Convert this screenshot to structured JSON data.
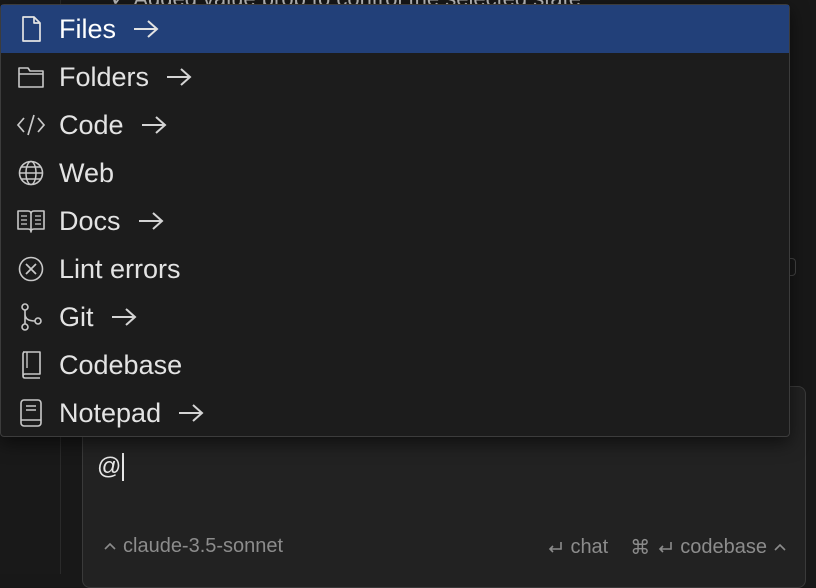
{
  "background": {
    "editor_text": "✓ Added value prop to control the selected state"
  },
  "menu": {
    "items": [
      {
        "label": "Files",
        "icon": "file-icon",
        "has_submenu": true,
        "selected": true
      },
      {
        "label": "Folders",
        "icon": "folder-icon",
        "has_submenu": true,
        "selected": false
      },
      {
        "label": "Code",
        "icon": "code-icon",
        "has_submenu": true,
        "selected": false
      },
      {
        "label": "Web",
        "icon": "globe-icon",
        "has_submenu": false,
        "selected": false
      },
      {
        "label": "Docs",
        "icon": "book-icon",
        "has_submenu": true,
        "selected": false
      },
      {
        "label": "Lint errors",
        "icon": "error-circle-icon",
        "has_submenu": false,
        "selected": false
      },
      {
        "label": "Git",
        "icon": "git-branch-icon",
        "has_submenu": true,
        "selected": false
      },
      {
        "label": "Codebase",
        "icon": "codebase-icon",
        "has_submenu": false,
        "selected": false
      },
      {
        "label": "Notepad",
        "icon": "notepad-icon",
        "has_submenu": true,
        "selected": false
      }
    ]
  },
  "composer": {
    "input_value": "@",
    "model_label": "claude-3.5-sonnet",
    "chat_label": "chat",
    "codebase_label": "codebase"
  },
  "colors": {
    "selected_background": "#224079",
    "menu_background": "#1c1c1c",
    "page_background": "#181818"
  }
}
